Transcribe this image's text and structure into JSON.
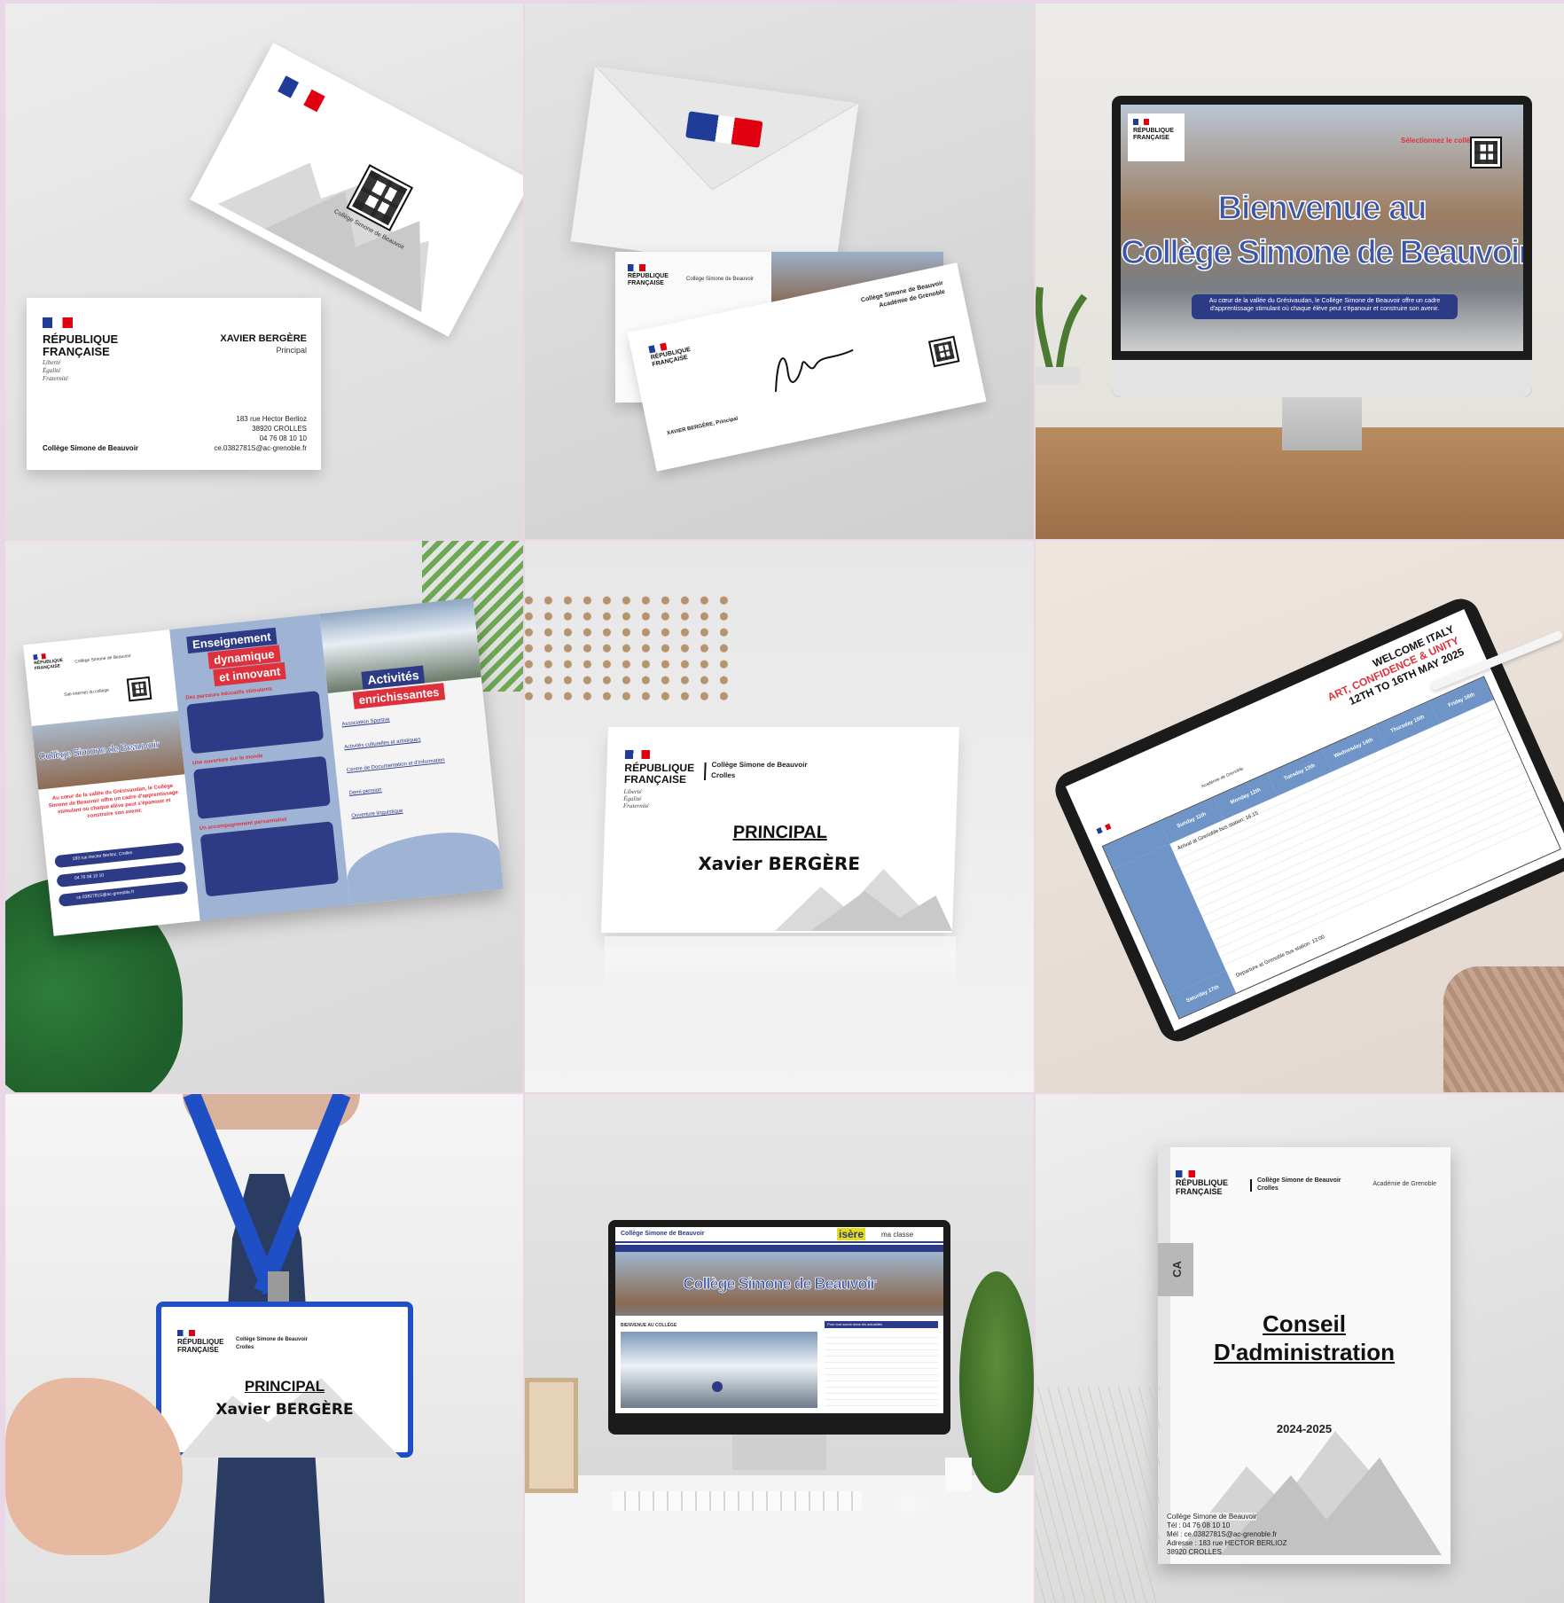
{
  "business_card": {
    "republique": [
      "RÉPUBLIQUE",
      "FRANÇAISE"
    ],
    "devise": [
      "Liberté",
      "Égalité",
      "Fraternité"
    ],
    "name": "XAVIER BERGÈRE",
    "role": "Principal",
    "address1": "183 rue Hector Berlioz",
    "address2": "38920 CROLLES",
    "phone": "04 76 08 10 10",
    "email": "ce.0382781S@ac-grenoble.fr",
    "college": "Collège Simone de Beauvoir",
    "back_caption": "Collège Simone de Beauvoir"
  },
  "envelope": {
    "republique": [
      "RÉPUBLIQUE",
      "FRANÇAISE"
    ],
    "college": "Collège Simone de Beauvoir",
    "academie": "Académie de Grenoble",
    "sender": "XAVIER BERGÈRE, Principal"
  },
  "monitor_welcome": {
    "republique": [
      "RÉPUBLIQUE",
      "FRANÇAISE"
    ],
    "link_label": "Sélectionnez le collège",
    "title1": "Bienvenue au",
    "title2": "Collège Simone de Beauvoir",
    "subtitle": "Au cœur de la vallée du Grésivaudan, le Collège Simone de Beauvoir offre un cadre d'apprentissage stimulant où chaque élève peut s'épanouir et construire son avenir."
  },
  "brochure": {
    "republique": [
      "RÉPUBLIQUE",
      "FRANÇAISE"
    ],
    "college": "Collège Simone de Beauvoir",
    "site_label": "Site internet du collège",
    "banner": "Collège Simone de Beauvoir",
    "intro": "Au cœur de la vallée du Grésivaudan, le Collège Simone de Beauvoir offre un cadre d'apprentissage stimulant où chaque élève peut s'épanouir et construire son avenir.",
    "contacts": [
      "183 rue Hector Berlioz, Crolles",
      "04 76 08 10 10",
      "ce.0382781S@ac-grenoble.fr"
    ],
    "heading1": "Enseignement",
    "heading2": "dynamique",
    "heading3": "et innovant",
    "section1": "Des parcours éducatifs stimulants",
    "section2": "Une ouverture sur le monde",
    "section3": "Un accompagnement personnalisé",
    "activites1": "Activités",
    "activites2": "enrichissantes",
    "activites_items": [
      "Association Sportive",
      "Activités culturelles et artistiques",
      "Centre de Documentation et d'Information",
      "Demi-pension",
      "Ouverture linguistique"
    ]
  },
  "tent_card": {
    "republique": [
      "RÉPUBLIQUE",
      "FRANÇAISE"
    ],
    "devise": [
      "Liberté",
      "Égalité",
      "Fraternité"
    ],
    "college": "Collège Simone de Beauvoir",
    "city": "Crolles",
    "role": "PRINCIPAL",
    "name": "Xavier BERGÈRE"
  },
  "tablet": {
    "title1": "WELCOME ITALY",
    "title2": "ART, CONFIDENCE & UNITY",
    "title3": "12TH TO 16TH MAY 2025",
    "academie": "Académie de Grenoble",
    "days": [
      "Sunday 11th",
      "Monday 12th",
      "Tuesday 13th",
      "Wednesday 14th",
      "Thursday 15th",
      "Friday 16th",
      "Saturday 17th"
    ],
    "arrival": "Arrival at Grenoble bus station: 16:15",
    "departure": "Departure at Grenoble bus station: 13:00"
  },
  "badge": {
    "republique": [
      "RÉPUBLIQUE",
      "FRANÇAISE"
    ],
    "college": "Collège Simone de Beauvoir",
    "city": "Crolles",
    "role": "PRINCIPAL",
    "name": "Xavier BERGÈRE"
  },
  "website": {
    "header_title": "Collège Simone de Beauvoir",
    "isere": "isère",
    "maclasse": "ma classe",
    "banner": "Collège Simone de Beauvoir",
    "section": "BIENVENUE AU COLLÈGE",
    "news_header": "Pour tout savoir dans les actualités"
  },
  "binder": {
    "republique": [
      "RÉPUBLIQUE",
      "FRANÇAISE"
    ],
    "college": "Collège Simone de Beauvoir",
    "city": "Crolles",
    "academie": "Académie de Grenoble",
    "spine": "CA",
    "title1": "Conseil",
    "title2": "D'administration",
    "year": "2024-2025",
    "footer": [
      "Collège Simone de Beauvoir",
      "Tél : 04 76 08 10 10",
      "Mél : ce.0382781S@ac-grenoble.fr",
      "Adresse : 183 rue HECTOR BERLIOZ",
      "38920 CROLLES"
    ]
  },
  "colors": {
    "flag_blue": "#1f3c98",
    "flag_red": "#e1000f",
    "brand_navy": "#2d3a86",
    "accent_red": "#e0303c"
  }
}
